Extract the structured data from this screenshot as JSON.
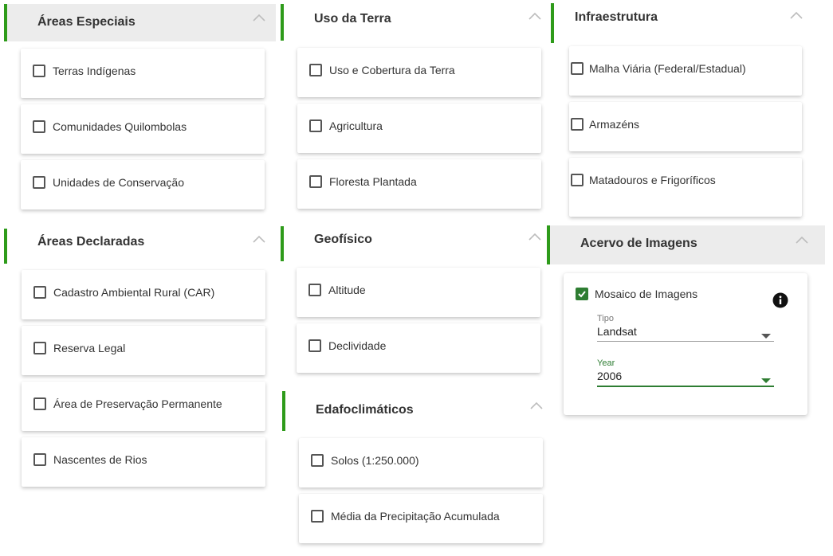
{
  "colors": {
    "accent": "#2e9b1a",
    "checked": "#2e7d32",
    "header_gray": "#ececec"
  },
  "areas_especiais": {
    "title": "Áreas Especiais",
    "items": [
      "Terras Indígenas",
      "Comunidades Quilombolas",
      "Unidades de Conservação"
    ]
  },
  "areas_declaradas": {
    "title": "Áreas Declaradas",
    "items": [
      "Cadastro Ambiental Rural (CAR)",
      "Reserva Legal",
      "Área de Preservação Permanente",
      "Nascentes de Rios"
    ]
  },
  "uso_da_terra": {
    "title": "Uso da Terra",
    "items": [
      "Uso e Cobertura da Terra",
      "Agricultura",
      "Floresta Plantada"
    ]
  },
  "geofisico": {
    "title": "Geofísico",
    "items": [
      "Altitude",
      "Declividade"
    ]
  },
  "edafoclimaticos": {
    "title": "Edafoclimáticos",
    "items": [
      "Solos (1:250.000)",
      "Média da Precipitação Acumulada"
    ]
  },
  "infraestrutura": {
    "title": "Infraestrutura",
    "items": [
      "Malha Viária (Federal/Estadual)",
      "Armazéns",
      "Matadouros e Frigoríficos"
    ]
  },
  "acervo_de_imagens": {
    "title": "Acervo de Imagens",
    "mosaico_label": "Mosaico de Imagens",
    "mosaico_checked": true,
    "tipo": {
      "label": "Tipo",
      "value": "Landsat"
    },
    "year": {
      "label": "Year",
      "value": "2006"
    }
  }
}
